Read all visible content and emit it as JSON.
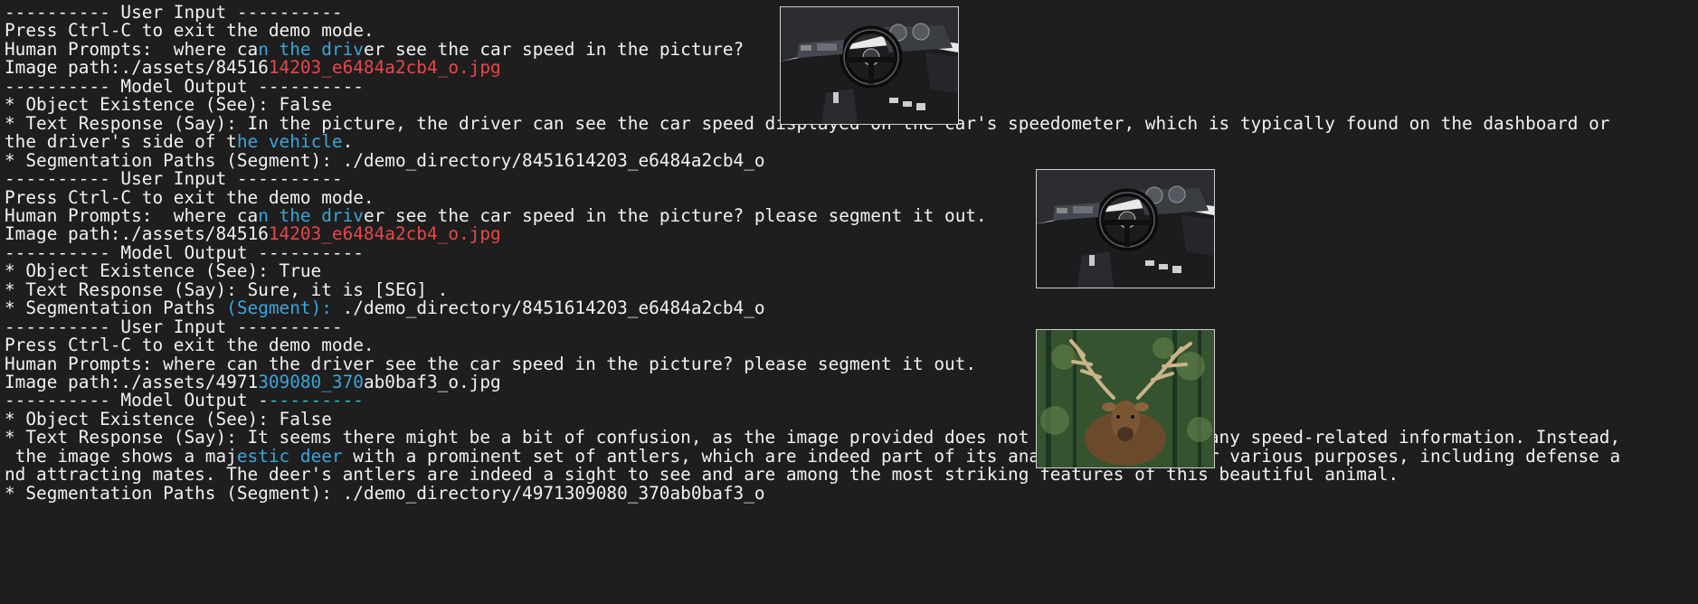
{
  "terminal": {
    "lines": [
      {
        "y": -8,
        "segments": [
          {
            "text": "---------- User Input ----------"
          }
        ]
      },
      {
        "y": 0,
        "segments": []
      },
      {
        "y": 0,
        "segments": []
      }
    ]
  },
  "blocks": [
    {
      "lines": [
        [
          {
            "t": "---------- User Input ----------"
          }
        ],
        [
          {
            "t": "Press Ctrl-C to exit the demo mode."
          }
        ],
        [
          {
            "t": "Human Prompts:  where ca"
          },
          {
            "t": "n the driv",
            "c": "blue"
          },
          {
            "t": "er see the car speed in the picture?"
          }
        ],
        [
          {
            "t": "Image path:./assets/84516"
          },
          {
            "t": "14203_e6484a2cb4_o.jpg",
            "c": "red"
          }
        ],
        [
          {
            "t": "---------- Model Output ----------"
          }
        ],
        [
          {
            "t": "* Object Existence (See): False"
          }
        ],
        [
          {
            "t": "* Text Response (Say): In the picture, the driver can see the car speed displayed on the car's speedometer, which is typically found on the dashboard or"
          }
        ],
        [
          {
            "t": "the driver's side of t"
          },
          {
            "t": "he vehicle",
            "c": "blue"
          },
          {
            "t": "."
          }
        ],
        [
          {
            "t": "* Segmentation Paths (Segment): ./demo_directory/8451614203_e6484a2cb4_o"
          }
        ]
      ]
    },
    {
      "lines": [
        [
          {
            "t": "---------- User Input ----------"
          }
        ],
        [
          {
            "t": "Press Ctrl-C to exit the demo mode."
          }
        ],
        [
          {
            "t": "Human Prompts:  where ca"
          },
          {
            "t": "n the driv",
            "c": "blue"
          },
          {
            "t": "er see the car speed in the picture? please segment it out."
          }
        ],
        [
          {
            "t": "Image path:./assets/84516"
          },
          {
            "t": "14203_e6484a2cb4_o.jpg",
            "c": "red"
          }
        ],
        [
          {
            "t": "---------- Model Output ----------"
          }
        ],
        [
          {
            "t": "* Object Existence (See): True"
          }
        ],
        [
          {
            "t": "* Text Response (Say): Sure, it is [SEG] ."
          }
        ],
        [
          {
            "t": "* Segmentation Paths "
          },
          {
            "t": "(Segment):",
            "c": "blue"
          },
          {
            "t": " ./demo_directory/8451614203_e6484a2cb4_o"
          }
        ]
      ]
    },
    {
      "lines": [
        [
          {
            "t": "---------- User Input ----------"
          }
        ],
        [
          {
            "t": "Press Ctrl-C to exit the demo mode."
          }
        ],
        [
          {
            "t": "Human Prompts: where can the driver see the car speed in the picture? please segment it out."
          }
        ],
        [
          {
            "t": "Image path:./assets/4971"
          },
          {
            "t": "309080_370",
            "c": "blue"
          },
          {
            "t": "ab0baf3_o.jpg"
          }
        ],
        [
          {
            "t": "---------- Model Output -"
          },
          {
            "t": "---------",
            "c": "teal"
          }
        ],
        [
          {
            "t": "* Object Existence (See): False"
          }
        ],
        [
          {
            "t": "* Text Response (Say): It seems there might be a bit of confusion, as the image provided does not depict a car or any speed-related information. Instead,"
          }
        ],
        [
          {
            "t": " the image shows a maj"
          },
          {
            "t": "estic deer",
            "c": "blue"
          },
          {
            "t": " with a prominent set of antlers, which are indeed part of its anatomy and used for various purposes, including defense a"
          }
        ],
        [
          {
            "t": "nd attracting mates. The deer's antlers are indeed a sight to see and are among the most striking features of this beautiful animal."
          }
        ],
        [
          {
            "t": "* Segmentation Paths (Segment): ./demo_directory/4971309080_370ab0baf3_o"
          }
        ]
      ]
    }
  ],
  "colors": {
    "background": "#1e1e1e",
    "text": "#f2f2f2",
    "blue": "#3aa6db",
    "red": "#e8474a",
    "teal": "#27c0c0"
  },
  "images": [
    {
      "name": "car-dashboard-thumbnail-1",
      "subject": "car interior dashboard"
    },
    {
      "name": "car-dashboard-thumbnail-2",
      "subject": "car interior dashboard"
    },
    {
      "name": "deer-thumbnail",
      "subject": "elk with antlers"
    }
  ]
}
